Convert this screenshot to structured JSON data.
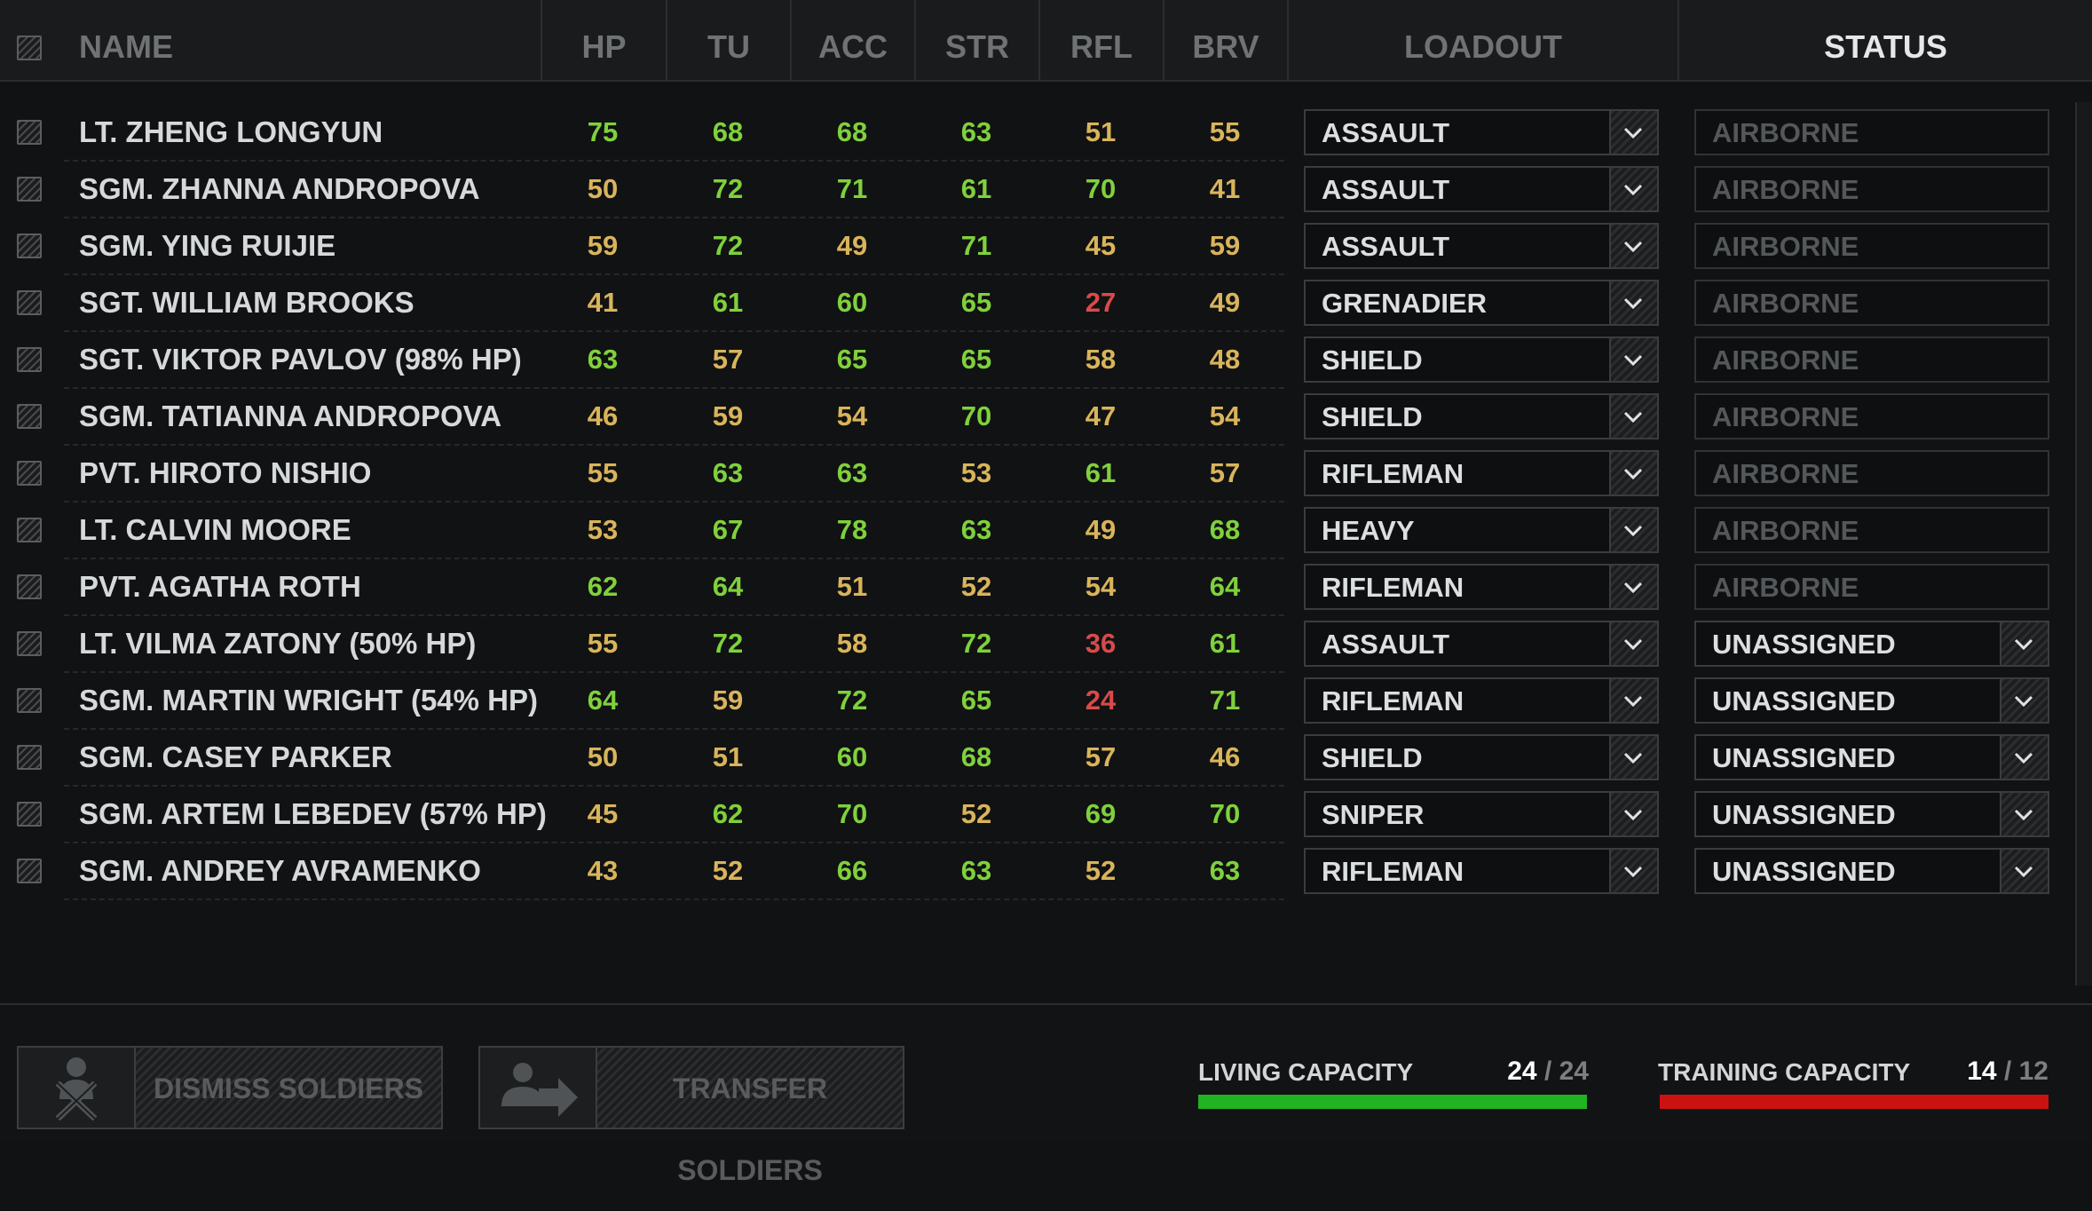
{
  "header": {
    "name": "NAME",
    "columns": [
      "HP",
      "TU",
      "ACC",
      "STR",
      "RFL",
      "BRV"
    ],
    "loadout": "LOADOUT",
    "status": "STATUS"
  },
  "colors": {
    "high": "#7fd13c",
    "mid": "#d9b45b",
    "low": "#d94a4a",
    "capacity_ok": "#22b322",
    "capacity_over": "#cc1111"
  },
  "soldiers": [
    {
      "name": "LT. ZHENG LONGYUN",
      "stats": [
        75,
        68,
        68,
        63,
        51,
        55
      ],
      "loadout": "ASSAULT",
      "status": "AIRBORNE"
    },
    {
      "name": "SGM. ZHANNA ANDROPOVA",
      "stats": [
        50,
        72,
        71,
        61,
        70,
        41
      ],
      "loadout": "ASSAULT",
      "status": "AIRBORNE"
    },
    {
      "name": "SGM. YING RUIJIE",
      "stats": [
        59,
        72,
        49,
        71,
        45,
        59
      ],
      "loadout": "ASSAULT",
      "status": "AIRBORNE"
    },
    {
      "name": "SGT. WILLIAM BROOKS",
      "stats": [
        41,
        61,
        60,
        65,
        27,
        49
      ],
      "loadout": "GRENADIER",
      "status": "AIRBORNE"
    },
    {
      "name": "SGT. VIKTOR PAVLOV (98% HP)",
      "stats": [
        63,
        57,
        65,
        65,
        58,
        48
      ],
      "loadout": "SHIELD",
      "status": "AIRBORNE"
    },
    {
      "name": "SGM. TATIANNA ANDROPOVA",
      "stats": [
        46,
        59,
        54,
        70,
        47,
        54
      ],
      "loadout": "SHIELD",
      "status": "AIRBORNE"
    },
    {
      "name": "PVT. HIROTO NISHIO",
      "stats": [
        55,
        63,
        63,
        53,
        61,
        57
      ],
      "loadout": "RIFLEMAN",
      "status": "AIRBORNE"
    },
    {
      "name": "LT. CALVIN MOORE",
      "stats": [
        53,
        67,
        78,
        63,
        49,
        68
      ],
      "loadout": "HEAVY",
      "status": "AIRBORNE"
    },
    {
      "name": "PVT. AGATHA ROTH",
      "stats": [
        62,
        64,
        51,
        52,
        54,
        64
      ],
      "loadout": "RIFLEMAN",
      "status": "AIRBORNE"
    },
    {
      "name": "LT. VILMA ZATONY (50% HP)",
      "stats": [
        55,
        72,
        58,
        72,
        36,
        61
      ],
      "loadout": "ASSAULT",
      "status": "UNASSIGNED"
    },
    {
      "name": "SGM. MARTIN WRIGHT (54% HP)",
      "stats": [
        64,
        59,
        72,
        65,
        24,
        71
      ],
      "loadout": "RIFLEMAN",
      "status": "UNASSIGNED"
    },
    {
      "name": "SGM. CASEY PARKER",
      "stats": [
        50,
        51,
        60,
        68,
        57,
        46
      ],
      "loadout": "SHIELD",
      "status": "UNASSIGNED"
    },
    {
      "name": "SGM. ARTEM LEBEDEV (57% HP)",
      "stats": [
        45,
        62,
        70,
        52,
        69,
        70
      ],
      "loadout": "SNIPER",
      "status": "UNASSIGNED"
    },
    {
      "name": "SGM. ANDREY AVRAMENKO",
      "stats": [
        43,
        52,
        66,
        63,
        52,
        63
      ],
      "loadout": "RIFLEMAN",
      "status": "UNASSIGNED"
    }
  ],
  "footer": {
    "dismiss_label": "DISMISS SOLDIERS",
    "transfer_label": "TRANSFER SOLDIERS",
    "living": {
      "label": "LIVING CAPACITY",
      "current": "24",
      "sep": "/",
      "max": "24"
    },
    "training": {
      "label": "TRAINING CAPACITY",
      "current": "14",
      "sep": "/",
      "max": "12"
    }
  }
}
